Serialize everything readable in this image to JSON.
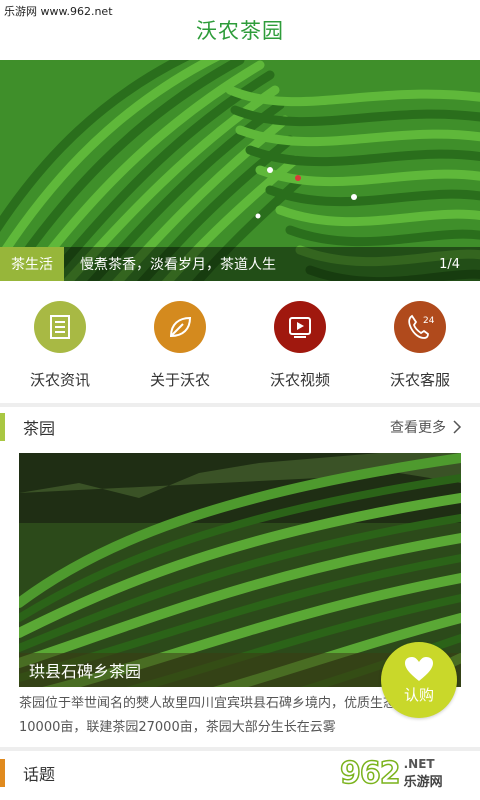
{
  "watermark": {
    "text": "乐游网 www.962.net"
  },
  "header": {
    "title": "沃农茶园"
  },
  "banner": {
    "tag": "茶生活",
    "caption": "慢煮茶香，淡看岁月，茶道人生",
    "page_indicator": "1/4"
  },
  "menu": {
    "items": [
      {
        "label": "沃农资讯",
        "icon": "news-icon",
        "color": "#a8b944"
      },
      {
        "label": "关于沃农",
        "icon": "leaf-icon",
        "color": "#d48a1e"
      },
      {
        "label": "沃农视频",
        "icon": "video-icon",
        "color": "#a0180e"
      },
      {
        "label": "沃农客服",
        "icon": "phone-24-icon",
        "color": "#b04a1c",
        "badge": "24"
      }
    ]
  },
  "section_garden": {
    "title": "茶园",
    "more_label": "查看更多"
  },
  "card": {
    "title": "珙县石碑乡茶园",
    "description": "茶园位于举世闻名的僰人故里四川宜宾珙县石碑乡境内，优质生态茶园10000亩，联建茶园27000亩，茶园大部分生长在云雾"
  },
  "fab": {
    "label": "认购",
    "icon": "heart-icon"
  },
  "section_topics": {
    "title": "话题"
  },
  "brand": {
    "num": "962",
    "net": ".NET",
    "cn": "乐游网"
  },
  "colors": {
    "brand_green": "#2e9c3a",
    "accent_olive": "#a9c742",
    "accent_orange": "#e08a1e",
    "fab": "#c9d82a"
  }
}
